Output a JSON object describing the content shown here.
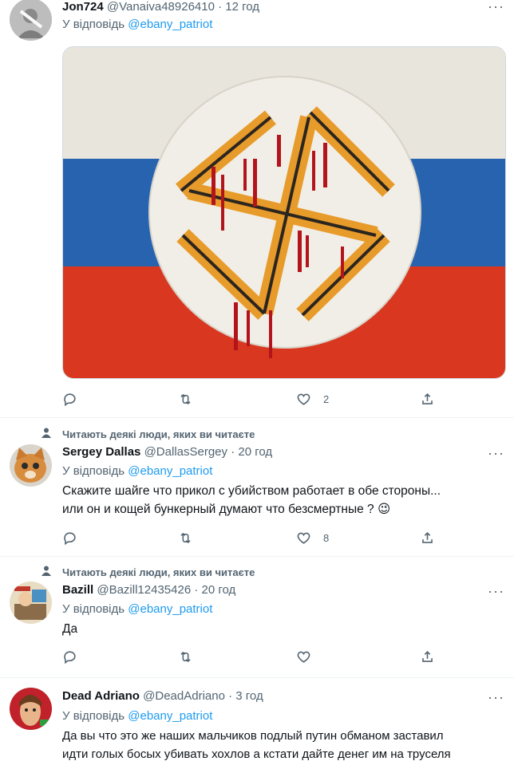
{
  "tweets": [
    {
      "name": "Jon724",
      "handle": "@Vanaiva48926410",
      "time": "12 год",
      "reply_label": "У відповідь",
      "reply_mention": "@ebany_patriot",
      "media": "russian-flag-bloody-swastika-image",
      "likes": "2"
    },
    {
      "social_context": "Читають деякі люди, яких ви читаєте",
      "name": "Sergey Dallas",
      "handle": "@DallasSergey",
      "time": "20 год",
      "reply_label": "У відповідь",
      "reply_mention": "@ebany_patriot",
      "text_line1": "Скажите шайге что прикол с убийством работает в обе стороны...",
      "text_line2": "или он и кощей бункерный думают что безсмертные ?",
      "emoji": "😉",
      "likes": "8"
    },
    {
      "social_context": "Читають деякі люди, яких ви читаєте",
      "name": "Bazill",
      "handle": "@Bazill12435426",
      "time": "20 год",
      "reply_label": "У відповідь",
      "reply_mention": "@ebany_patriot",
      "text_line1": "Да"
    },
    {
      "name": "Dead Adriano",
      "handle": "@DeadAdriano",
      "time": "3 год",
      "reply_label": "У відповідь",
      "reply_mention": "@ebany_patriot",
      "text_line1": "Да вы что это же наших мальчиков подлый путин обманом заставил",
      "text_line2": "идти голых босых убивать хохлов а кстати дайте денег им на труселя"
    }
  ],
  "separator": "·",
  "more_glyph": "···",
  "colors": {
    "link": "#1d9bf0",
    "secondary": "#536471",
    "flag_white": "#f2efe6",
    "flag_blue": "#2a68b8",
    "flag_red": "#e23a22"
  }
}
